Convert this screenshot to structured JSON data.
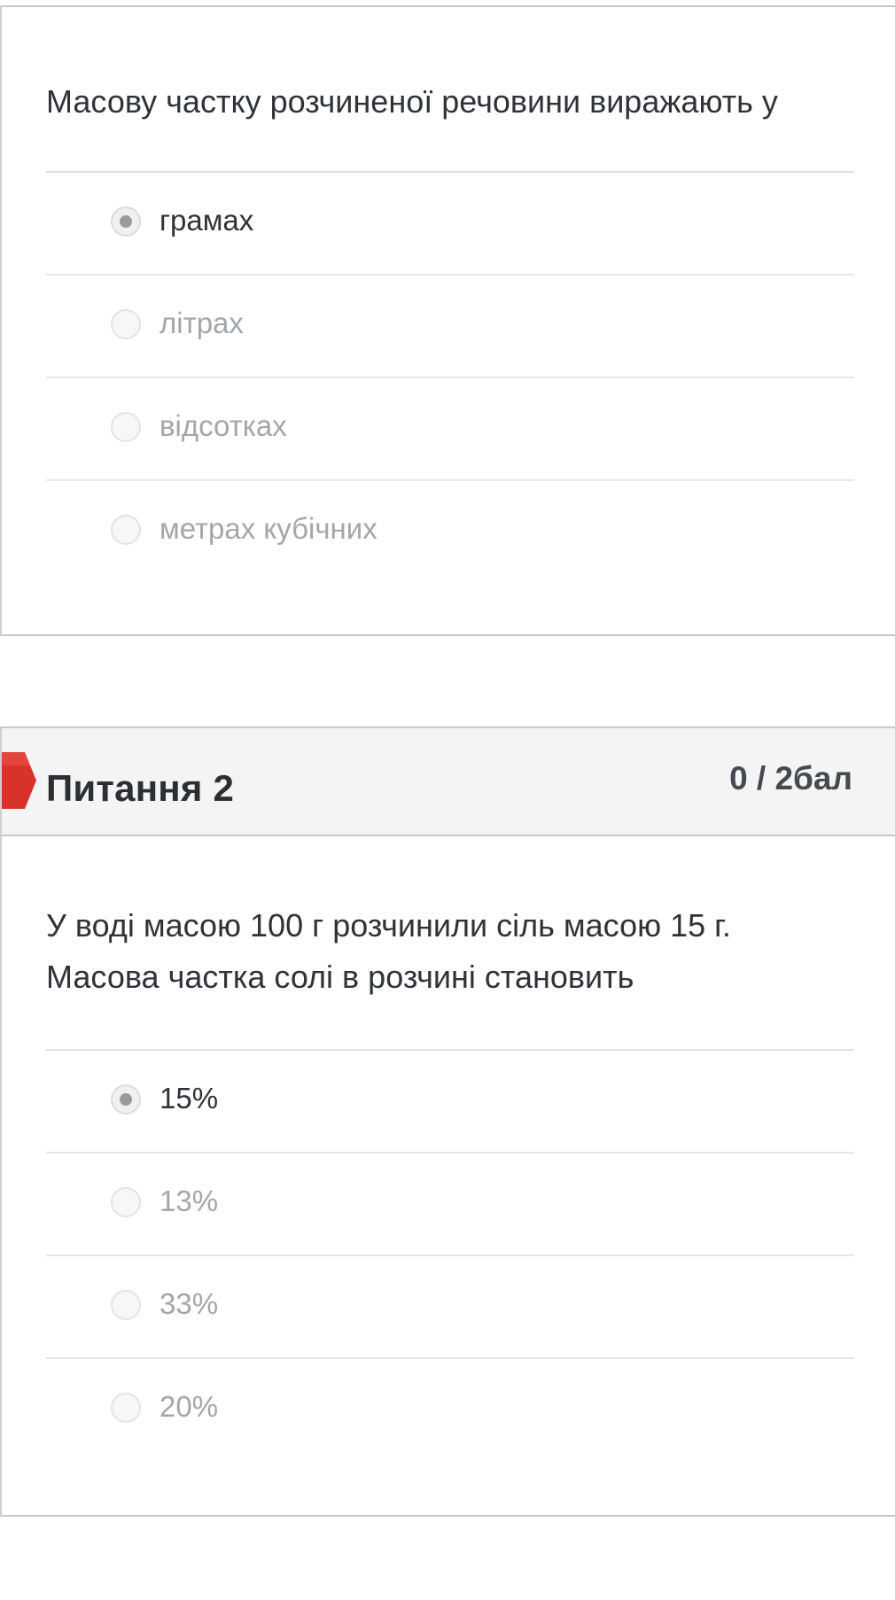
{
  "question1": {
    "text": "Масову частку розчиненої речовини виражають у",
    "answers": [
      {
        "label": "грамах",
        "selected": true
      },
      {
        "label": "літрах",
        "selected": false
      },
      {
        "label": "відсотках",
        "selected": false
      },
      {
        "label": "метрах кубічних",
        "selected": false
      }
    ]
  },
  "question2": {
    "title": "Питання 2",
    "score": "0 / 2бал",
    "flag_color": "#d9322b",
    "text_line1": "У воді масою 100 г розчинили сіль масою 15 г.",
    "text_line2": "Масова частка солі в розчині становить",
    "answers": [
      {
        "label": "15%",
        "selected": true
      },
      {
        "label": "13%",
        "selected": false
      },
      {
        "label": "33%",
        "selected": false
      },
      {
        "label": "20%",
        "selected": false
      }
    ]
  }
}
